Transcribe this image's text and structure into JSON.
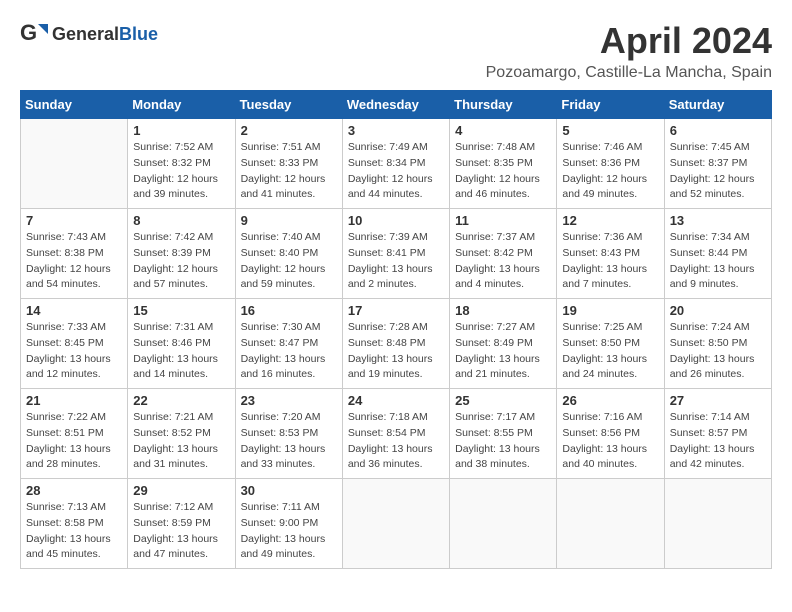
{
  "header": {
    "logo_general": "General",
    "logo_blue": "Blue",
    "title": "April 2024",
    "location": "Pozoamargo, Castille-La Mancha, Spain"
  },
  "columns": [
    "Sunday",
    "Monday",
    "Tuesday",
    "Wednesday",
    "Thursday",
    "Friday",
    "Saturday"
  ],
  "weeks": [
    [
      {
        "day": "",
        "info": ""
      },
      {
        "day": "1",
        "info": "Sunrise: 7:52 AM\nSunset: 8:32 PM\nDaylight: 12 hours\nand 39 minutes."
      },
      {
        "day": "2",
        "info": "Sunrise: 7:51 AM\nSunset: 8:33 PM\nDaylight: 12 hours\nand 41 minutes."
      },
      {
        "day": "3",
        "info": "Sunrise: 7:49 AM\nSunset: 8:34 PM\nDaylight: 12 hours\nand 44 minutes."
      },
      {
        "day": "4",
        "info": "Sunrise: 7:48 AM\nSunset: 8:35 PM\nDaylight: 12 hours\nand 46 minutes."
      },
      {
        "day": "5",
        "info": "Sunrise: 7:46 AM\nSunset: 8:36 PM\nDaylight: 12 hours\nand 49 minutes."
      },
      {
        "day": "6",
        "info": "Sunrise: 7:45 AM\nSunset: 8:37 PM\nDaylight: 12 hours\nand 52 minutes."
      }
    ],
    [
      {
        "day": "7",
        "info": "Sunrise: 7:43 AM\nSunset: 8:38 PM\nDaylight: 12 hours\nand 54 minutes."
      },
      {
        "day": "8",
        "info": "Sunrise: 7:42 AM\nSunset: 8:39 PM\nDaylight: 12 hours\nand 57 minutes."
      },
      {
        "day": "9",
        "info": "Sunrise: 7:40 AM\nSunset: 8:40 PM\nDaylight: 12 hours\nand 59 minutes."
      },
      {
        "day": "10",
        "info": "Sunrise: 7:39 AM\nSunset: 8:41 PM\nDaylight: 13 hours\nand 2 minutes."
      },
      {
        "day": "11",
        "info": "Sunrise: 7:37 AM\nSunset: 8:42 PM\nDaylight: 13 hours\nand 4 minutes."
      },
      {
        "day": "12",
        "info": "Sunrise: 7:36 AM\nSunset: 8:43 PM\nDaylight: 13 hours\nand 7 minutes."
      },
      {
        "day": "13",
        "info": "Sunrise: 7:34 AM\nSunset: 8:44 PM\nDaylight: 13 hours\nand 9 minutes."
      }
    ],
    [
      {
        "day": "14",
        "info": "Sunrise: 7:33 AM\nSunset: 8:45 PM\nDaylight: 13 hours\nand 12 minutes."
      },
      {
        "day": "15",
        "info": "Sunrise: 7:31 AM\nSunset: 8:46 PM\nDaylight: 13 hours\nand 14 minutes."
      },
      {
        "day": "16",
        "info": "Sunrise: 7:30 AM\nSunset: 8:47 PM\nDaylight: 13 hours\nand 16 minutes."
      },
      {
        "day": "17",
        "info": "Sunrise: 7:28 AM\nSunset: 8:48 PM\nDaylight: 13 hours\nand 19 minutes."
      },
      {
        "day": "18",
        "info": "Sunrise: 7:27 AM\nSunset: 8:49 PM\nDaylight: 13 hours\nand 21 minutes."
      },
      {
        "day": "19",
        "info": "Sunrise: 7:25 AM\nSunset: 8:50 PM\nDaylight: 13 hours\nand 24 minutes."
      },
      {
        "day": "20",
        "info": "Sunrise: 7:24 AM\nSunset: 8:50 PM\nDaylight: 13 hours\nand 26 minutes."
      }
    ],
    [
      {
        "day": "21",
        "info": "Sunrise: 7:22 AM\nSunset: 8:51 PM\nDaylight: 13 hours\nand 28 minutes."
      },
      {
        "day": "22",
        "info": "Sunrise: 7:21 AM\nSunset: 8:52 PM\nDaylight: 13 hours\nand 31 minutes."
      },
      {
        "day": "23",
        "info": "Sunrise: 7:20 AM\nSunset: 8:53 PM\nDaylight: 13 hours\nand 33 minutes."
      },
      {
        "day": "24",
        "info": "Sunrise: 7:18 AM\nSunset: 8:54 PM\nDaylight: 13 hours\nand 36 minutes."
      },
      {
        "day": "25",
        "info": "Sunrise: 7:17 AM\nSunset: 8:55 PM\nDaylight: 13 hours\nand 38 minutes."
      },
      {
        "day": "26",
        "info": "Sunrise: 7:16 AM\nSunset: 8:56 PM\nDaylight: 13 hours\nand 40 minutes."
      },
      {
        "day": "27",
        "info": "Sunrise: 7:14 AM\nSunset: 8:57 PM\nDaylight: 13 hours\nand 42 minutes."
      }
    ],
    [
      {
        "day": "28",
        "info": "Sunrise: 7:13 AM\nSunset: 8:58 PM\nDaylight: 13 hours\nand 45 minutes."
      },
      {
        "day": "29",
        "info": "Sunrise: 7:12 AM\nSunset: 8:59 PM\nDaylight: 13 hours\nand 47 minutes."
      },
      {
        "day": "30",
        "info": "Sunrise: 7:11 AM\nSunset: 9:00 PM\nDaylight: 13 hours\nand 49 minutes."
      },
      {
        "day": "",
        "info": ""
      },
      {
        "day": "",
        "info": ""
      },
      {
        "day": "",
        "info": ""
      },
      {
        "day": "",
        "info": ""
      }
    ]
  ]
}
